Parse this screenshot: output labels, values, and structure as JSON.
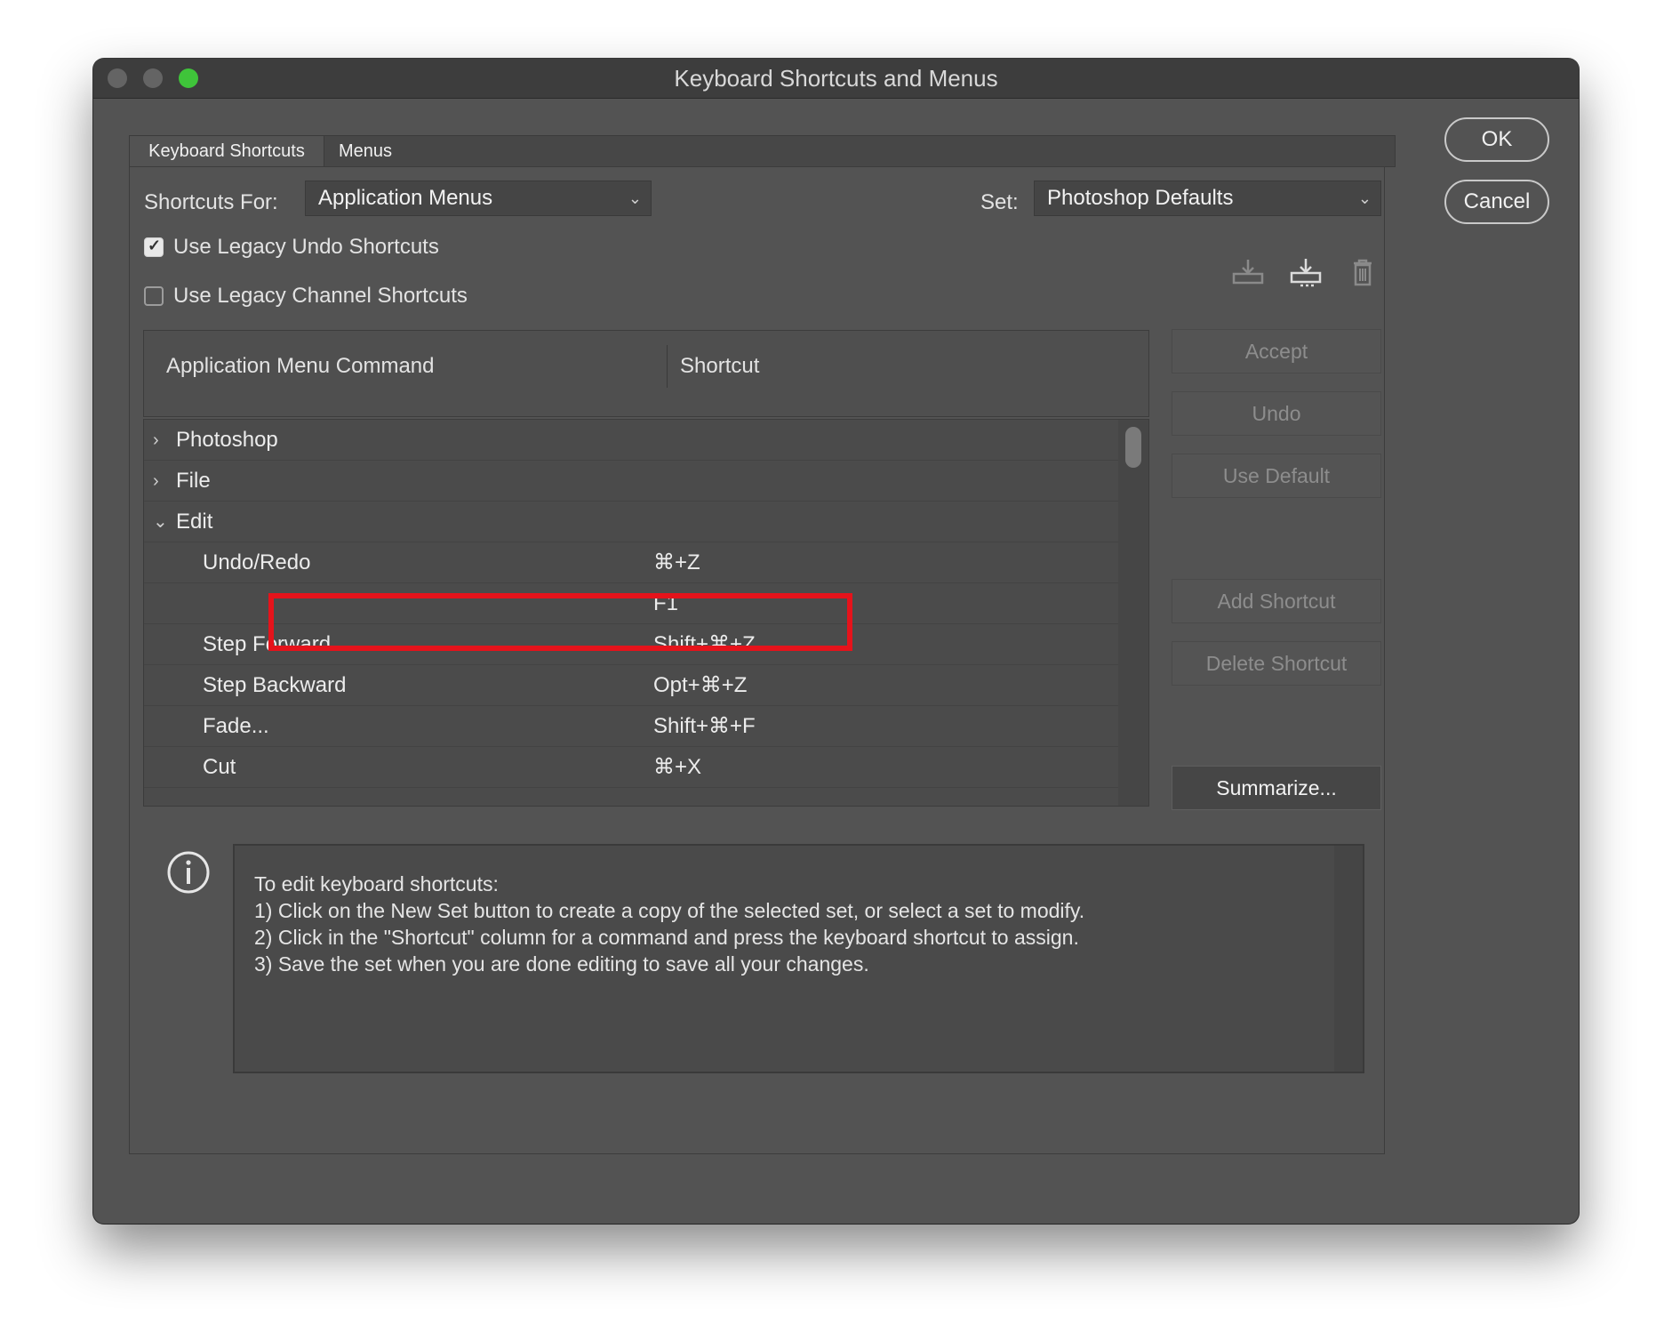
{
  "window": {
    "title": "Keyboard Shortcuts and Menus"
  },
  "dialog_buttons": {
    "ok": "OK",
    "cancel": "Cancel"
  },
  "tabs": [
    {
      "label": "Keyboard Shortcuts",
      "active": true
    },
    {
      "label": "Menus",
      "active": false
    }
  ],
  "shortcuts_for": {
    "label": "Shortcuts For:",
    "value": "Application Menus"
  },
  "set": {
    "label": "Set:",
    "value": "Photoshop Defaults"
  },
  "options": [
    {
      "label": "Use Legacy Undo Shortcuts",
      "checked": true
    },
    {
      "label": "Use Legacy Channel Shortcuts",
      "checked": false
    }
  ],
  "icons": [
    "save-set-icon",
    "new-set-icon",
    "delete-set-icon"
  ],
  "table": {
    "columns": [
      "Application Menu Command",
      "Shortcut"
    ],
    "rows": [
      {
        "type": "group",
        "expanded": false,
        "command": "Photoshop",
        "shortcut": ""
      },
      {
        "type": "group",
        "expanded": false,
        "command": "File",
        "shortcut": ""
      },
      {
        "type": "group",
        "expanded": true,
        "command": "Edit",
        "shortcut": ""
      },
      {
        "type": "item",
        "command": "Undo/Redo",
        "shortcut": "⌘+Z"
      },
      {
        "type": "item",
        "command": "",
        "shortcut": "F1"
      },
      {
        "type": "item",
        "command": "Step Forward",
        "shortcut": "Shift+⌘+Z"
      },
      {
        "type": "item",
        "command": "Step Backward",
        "shortcut": "Opt+⌘+Z"
      },
      {
        "type": "item",
        "command": "Fade...",
        "shortcut": "Shift+⌘+F"
      },
      {
        "type": "item",
        "command": "Cut",
        "shortcut": "⌘+X"
      }
    ]
  },
  "side_buttons": {
    "accept": "Accept",
    "undo": "Undo",
    "use_default": "Use Default",
    "add_shortcut": "Add Shortcut",
    "delete_shortcut": "Delete Shortcut",
    "summarize": "Summarize..."
  },
  "info": {
    "lines": [
      "To edit keyboard shortcuts:",
      "1) Click on the New Set button to create a copy of the selected set, or select a set to modify.",
      "2) Click in the \"Shortcut\" column for a command and press the keyboard shortcut to assign.",
      "3) Save the set when you are done editing to save all your changes."
    ]
  },
  "colors": {
    "window_bg": "#535353",
    "highlight": "#e5131b",
    "maximize": "#3fc43a"
  }
}
